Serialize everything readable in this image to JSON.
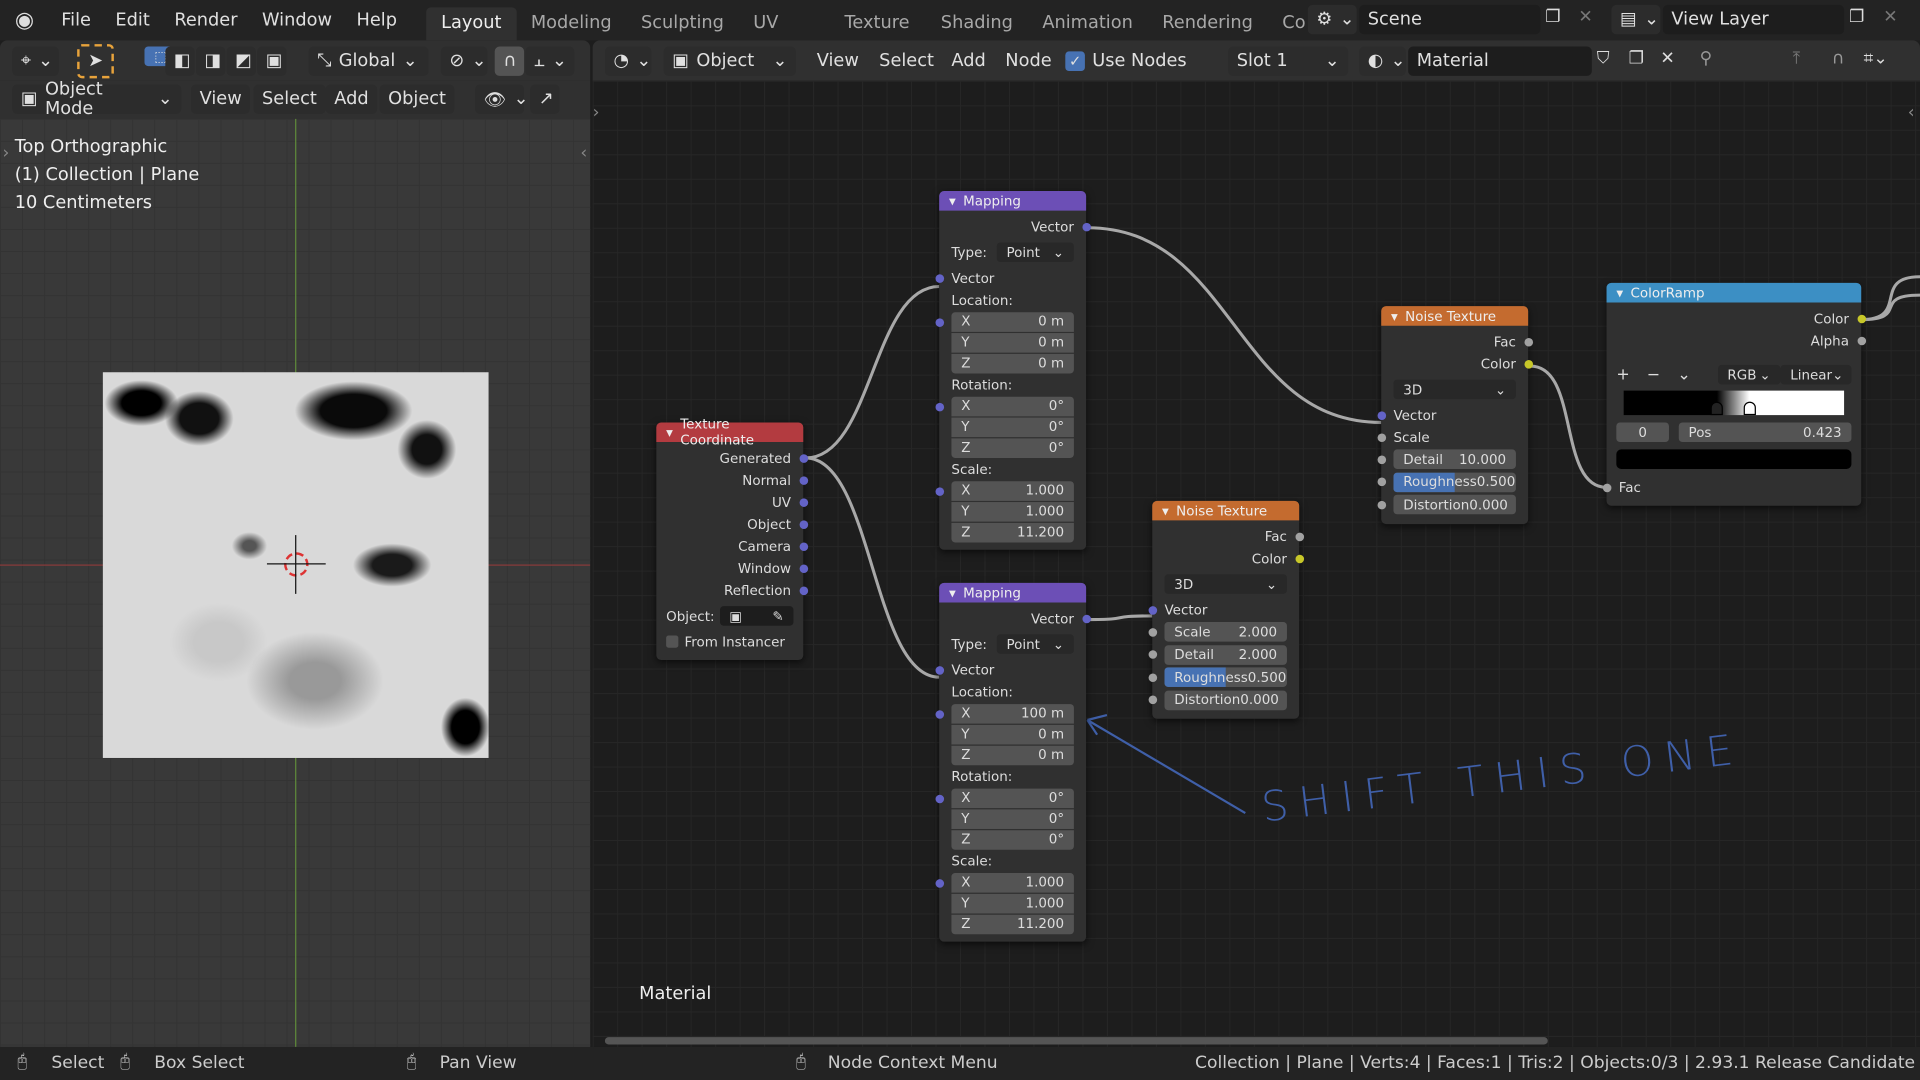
{
  "topbar": {
    "menus": [
      "File",
      "Edit",
      "Render",
      "Window",
      "Help"
    ],
    "workspaces": [
      "Layout",
      "Modeling",
      "Sculpting",
      "UV Editing",
      "Texture Paint",
      "Shading",
      "Animation",
      "Rendering",
      "Co"
    ],
    "active_workspace": "Layout",
    "scene": "Scene",
    "view_layer": "View Layer"
  },
  "viewport": {
    "orientation_label": "Global",
    "mode": "Object Mode",
    "menus": [
      "View",
      "Select",
      "Add",
      "Object"
    ],
    "overlay_lines": [
      "Top Orthographic",
      "(1) Collection | Plane",
      "10 Centimeters"
    ]
  },
  "node_editor": {
    "object_type": "Object",
    "menus": [
      "View",
      "Select",
      "Add",
      "Node"
    ],
    "use_nodes_label": "Use Nodes",
    "use_nodes": true,
    "slot": "Slot 1",
    "material": "Material",
    "material_label": "Material"
  },
  "colors": {
    "vector_socket": "#6363c7",
    "color_socket": "#c7c729",
    "float_socket": "#a1a1a1",
    "input_header": "#b33b40",
    "vector_header": "#6c4fb6",
    "texture_header": "#c46b2f",
    "converter_header": "#3c8fc4",
    "annotation": "#3f5fa8"
  },
  "nodes": [
    {
      "id": "mapping1",
      "title": "Mapping",
      "header": "vector_header",
      "rows": [
        {
          "t": "out",
          "label": "Vector",
          "s": "vector"
        },
        {
          "t": "sel",
          "label": "Type:",
          "value": "Point"
        },
        {
          "t": "in",
          "label": "Vector",
          "s": "vector"
        },
        {
          "t": "lbl",
          "label": "Location:"
        },
        {
          "t": "fld",
          "axis": "X",
          "value": "0 m",
          "s": "vector"
        },
        {
          "t": "fld",
          "axis": "Y",
          "value": "0 m"
        },
        {
          "t": "fld",
          "axis": "Z",
          "value": "0 m"
        },
        {
          "t": "lbl",
          "label": "Rotation:"
        },
        {
          "t": "fld",
          "axis": "X",
          "value": "0°",
          "s": "vector"
        },
        {
          "t": "fld",
          "axis": "Y",
          "value": "0°"
        },
        {
          "t": "fld",
          "axis": "Z",
          "value": "0°"
        },
        {
          "t": "lbl",
          "label": "Scale:"
        },
        {
          "t": "fld",
          "axis": "X",
          "value": "1.000",
          "s": "vector"
        },
        {
          "t": "fld",
          "axis": "Y",
          "value": "1.000"
        },
        {
          "t": "fld",
          "axis": "Z",
          "value": "11.200"
        }
      ]
    },
    {
      "id": "mapping2",
      "title": "Mapping",
      "header": "vector_header",
      "rows": [
        {
          "t": "out",
          "label": "Vector",
          "s": "vector"
        },
        {
          "t": "sel",
          "label": "Type:",
          "value": "Point"
        },
        {
          "t": "in",
          "label": "Vector",
          "s": "vector"
        },
        {
          "t": "lbl",
          "label": "Location:"
        },
        {
          "t": "fld",
          "axis": "X",
          "value": "100 m",
          "s": "vector"
        },
        {
          "t": "fld",
          "axis": "Y",
          "value": "0 m"
        },
        {
          "t": "fld",
          "axis": "Z",
          "value": "0 m"
        },
        {
          "t": "lbl",
          "label": "Rotation:"
        },
        {
          "t": "fld",
          "axis": "X",
          "value": "0°",
          "s": "vector"
        },
        {
          "t": "fld",
          "axis": "Y",
          "value": "0°"
        },
        {
          "t": "fld",
          "axis": "Z",
          "value": "0°"
        },
        {
          "t": "lbl",
          "label": "Scale:"
        },
        {
          "t": "fld",
          "axis": "X",
          "value": "1.000",
          "s": "vector"
        },
        {
          "t": "fld",
          "axis": "Y",
          "value": "1.000"
        },
        {
          "t": "fld",
          "axis": "Z",
          "value": "11.200"
        }
      ]
    },
    {
      "id": "texcoord",
      "title": "Texture Coordinate",
      "header": "input_header",
      "rows": [
        {
          "t": "out",
          "label": "Generated",
          "s": "vector"
        },
        {
          "t": "out",
          "label": "Normal",
          "s": "vector"
        },
        {
          "t": "out",
          "label": "UV",
          "s": "vector"
        },
        {
          "t": "out",
          "label": "Object",
          "s": "vector"
        },
        {
          "t": "out",
          "label": "Camera",
          "s": "vector"
        },
        {
          "t": "out",
          "label": "Window",
          "s": "vector"
        },
        {
          "t": "out",
          "label": "Reflection",
          "s": "vector"
        },
        {
          "t": "obj",
          "label": "Object:"
        },
        {
          "t": "chk",
          "label": "From Instancer"
        }
      ]
    },
    {
      "id": "noise2",
      "title": "Noise Texture",
      "header": "texture_header",
      "rows": [
        {
          "t": "out",
          "label": "Fac",
          "s": "float"
        },
        {
          "t": "out",
          "label": "Color",
          "s": "color"
        },
        {
          "t": "sel",
          "value": "3D"
        },
        {
          "t": "in",
          "label": "Vector",
          "s": "vector"
        },
        {
          "t": "slider",
          "label": "Scale",
          "value": "2.000",
          "s": "float"
        },
        {
          "t": "slider",
          "label": "Detail",
          "value": "2.000",
          "s": "float"
        },
        {
          "t": "slider",
          "label": "Roughness",
          "value": "0.500",
          "s": "float",
          "fill": 0.5
        },
        {
          "t": "slider",
          "label": "Distortion",
          "value": "0.000",
          "s": "float"
        }
      ]
    },
    {
      "id": "noise1",
      "title": "Noise Texture",
      "header": "texture_header",
      "rows": [
        {
          "t": "out",
          "label": "Fac",
          "s": "float"
        },
        {
          "t": "out",
          "label": "Color",
          "s": "color"
        },
        {
          "t": "sel",
          "value": "3D"
        },
        {
          "t": "in",
          "label": "Vector",
          "s": "vector"
        },
        {
          "t": "in",
          "label": "Scale",
          "s": "float"
        },
        {
          "t": "slider",
          "label": "Detail",
          "value": "10.000",
          "s": "float"
        },
        {
          "t": "slider",
          "label": "Roughness",
          "value": "0.500",
          "s": "float",
          "fill": 0.5
        },
        {
          "t": "slider",
          "label": "Distortion",
          "value": "0.000",
          "s": "float"
        }
      ]
    },
    {
      "id": "colorramp",
      "title": "ColorRamp",
      "header": "converter_header",
      "rows": [
        {
          "t": "out",
          "label": "Color",
          "s": "color"
        },
        {
          "t": "out",
          "label": "Alpha",
          "s": "float"
        },
        {
          "t": "ramp",
          "mode": "RGB",
          "interp": "Linear",
          "index": "0",
          "pos_label": "Pos",
          "pos": "0.423",
          "stops": [
            0.423,
            0.57
          ]
        },
        {
          "t": "in",
          "label": "Fac",
          "s": "float"
        }
      ]
    }
  ],
  "annotation": {
    "text": "SHIFT THIS ONE"
  },
  "statusbar": {
    "items": [
      "Select",
      "Box Select",
      "Pan View",
      "Node Context Menu"
    ],
    "info": "Collection | Plane | Verts:4 | Faces:1 | Tris:2 | Objects:0/3 | 2.93.1 Release Candidate"
  }
}
